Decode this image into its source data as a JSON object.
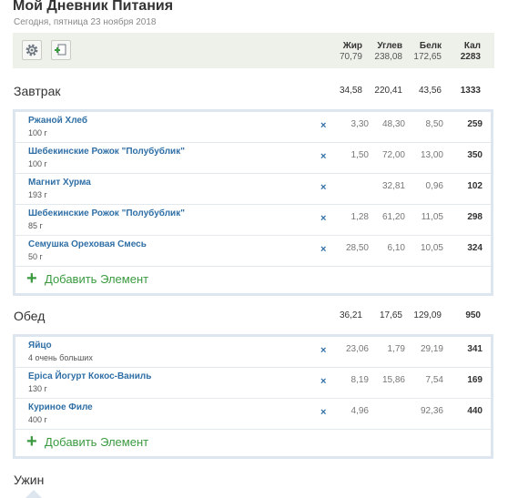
{
  "header": {
    "title": "Мой Дневник Питания",
    "date": "Сегодня, пятница 23 ноября 2018"
  },
  "toolbar": {
    "settings_icon": "gear-icon",
    "add_icon": "add-document-icon"
  },
  "columns": {
    "fat": "Жир",
    "carbs": "Углев",
    "protein": "Белк",
    "kcal": "Кал"
  },
  "daily_totals": {
    "fat": "70,79",
    "carbs": "238,08",
    "protein": "172,65",
    "kcal": "2283"
  },
  "remove_symbol": "×",
  "add_label": "Добавить Элемент",
  "add_icon": "+",
  "meals": [
    {
      "name": "Завтрак",
      "totals": {
        "fat": "34,58",
        "carbs": "220,41",
        "protein": "43,56",
        "kcal": "1333"
      },
      "items": [
        {
          "name": "Ржаной Хлеб",
          "qty": "100 г",
          "fat": "3,30",
          "carbs": "48,30",
          "protein": "8,50",
          "kcal": "259"
        },
        {
          "name": "Шебекинские Рожок \"Полубублик\"",
          "qty": "100 г",
          "fat": "1,50",
          "carbs": "72,00",
          "protein": "13,00",
          "kcal": "350"
        },
        {
          "name": "Магнит Хурма",
          "qty": "193 г",
          "fat": "",
          "carbs": "32,81",
          "protein": "0,96",
          "kcal": "102"
        },
        {
          "name": "Шебекинские Рожок \"Полубублик\"",
          "qty": "85 г",
          "fat": "1,28",
          "carbs": "61,20",
          "protein": "11,05",
          "kcal": "298"
        },
        {
          "name": "Семушка Ореховая Смесь",
          "qty": "50 г",
          "fat": "28,50",
          "carbs": "6,10",
          "protein": "10,05",
          "kcal": "324"
        }
      ]
    },
    {
      "name": "Обед",
      "totals": {
        "fat": "36,21",
        "carbs": "17,65",
        "protein": "129,09",
        "kcal": "950"
      },
      "items": [
        {
          "name": "Яйцо",
          "qty": "4 очень больших",
          "fat": "23,06",
          "carbs": "1,79",
          "protein": "29,19",
          "kcal": "341"
        },
        {
          "name": "Epica Йогурт Кокос-Ваниль",
          "qty": "130 г",
          "fat": "8,19",
          "carbs": "15,86",
          "protein": "7,54",
          "kcal": "169"
        },
        {
          "name": "Куриное Филе",
          "qty": "400 г",
          "fat": "4,96",
          "carbs": "",
          "protein": "92,36",
          "kcal": "440"
        }
      ]
    },
    {
      "name": "Ужин",
      "totals": {
        "fat": "",
        "carbs": "",
        "protein": "",
        "kcal": ""
      },
      "items": []
    }
  ]
}
